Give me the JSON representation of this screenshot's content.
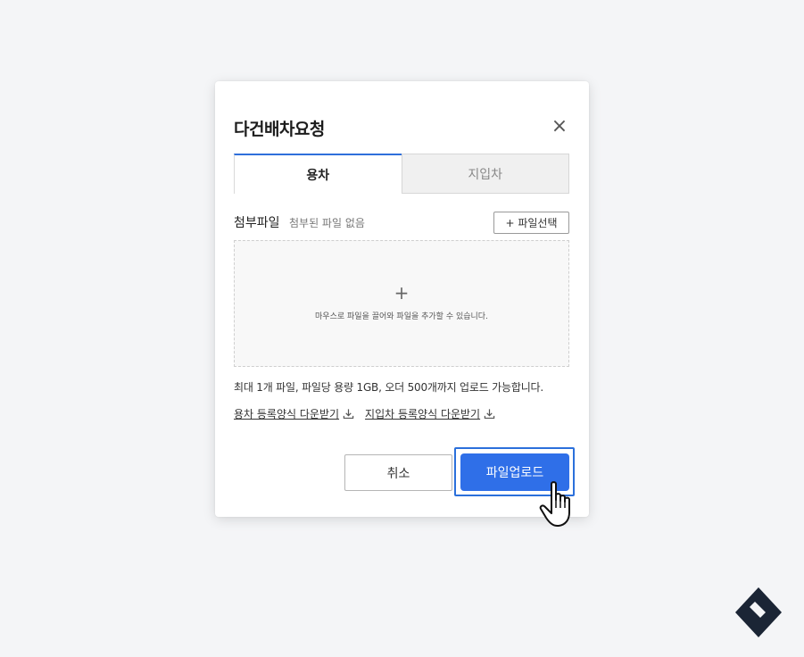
{
  "modal": {
    "title": "다건배차요청",
    "close_icon": "×"
  },
  "tabs": [
    {
      "label": "용차",
      "active": true
    },
    {
      "label": "지입차",
      "active": false
    }
  ],
  "attachment": {
    "label": "첨부파일",
    "status": "첨부된 파일 없음",
    "select_button": "+ 파일선택"
  },
  "dropzone": {
    "plus": "+",
    "hint": "마우스로 파일을 끌어와 파일을 추가할 수 있습니다."
  },
  "limit_text": "최대 1개 파일, 파일당 용량 1GB, 오더 500개까지 업로드 가능합니다.",
  "download_links": [
    {
      "label": "용차 등록양식 다운받기",
      "icon": "download-icon"
    },
    {
      "label": "지입차 등록양식 다운받기",
      "icon": "download-icon"
    }
  ],
  "buttons": {
    "cancel": "취소",
    "upload": "파일업로드"
  },
  "colors": {
    "primary": "#2f6fe8",
    "tab_accent": "#2f6fdb",
    "background": "#f4f5f7"
  }
}
